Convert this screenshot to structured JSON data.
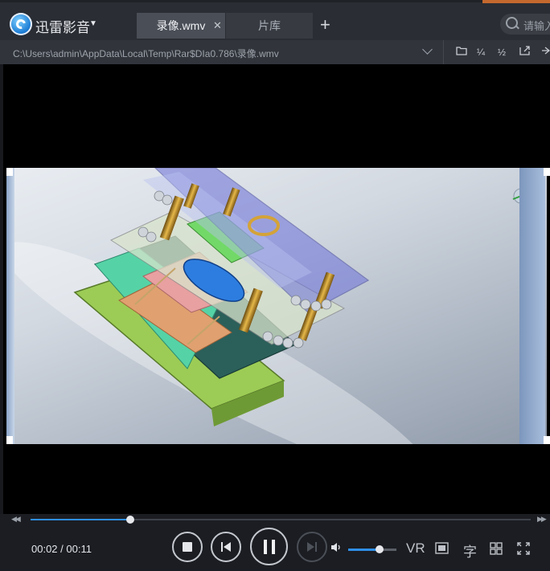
{
  "app": {
    "title": "迅雷影音"
  },
  "tabs": [
    {
      "label": "录像.wmv",
      "active": true
    },
    {
      "label": "片库",
      "active": false
    }
  ],
  "search": {
    "placeholder": "请输入"
  },
  "pathbar": {
    "path": "C:\\Users\\admin\\AppData\\Local\\Temp\\Rar$DIa0.786\\录像.wmv"
  },
  "playback": {
    "current_time": "00:02",
    "separator": "/",
    "total_time": "00:11",
    "progress_fraction": 0.2,
    "volume_fraction": 0.65
  },
  "right_controls": {
    "vr_label": "VR",
    "subtitle_label": "字"
  },
  "colors": {
    "accent": "#2f8fe8",
    "titlebar": "#2a2d33",
    "background": "#17191e"
  }
}
